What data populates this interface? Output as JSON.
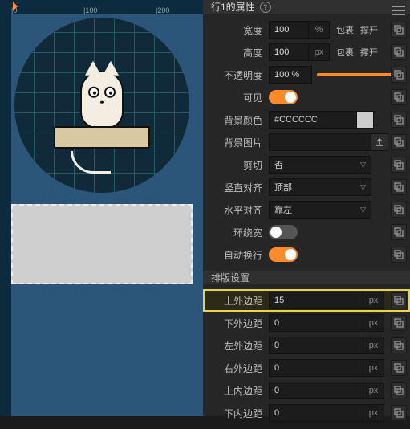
{
  "ruler": {
    "m0": "|0",
    "m100": "|100",
    "m200": "|200"
  },
  "panel": {
    "title": "行1的属性",
    "section_layout": "排版设置"
  },
  "props": {
    "width_label": "宽度",
    "width_value": "100",
    "width_unit": "%",
    "height_label": "高度",
    "height_value": "100",
    "height_unit": "px",
    "opacity_label": "不透明度",
    "opacity_value": "100 %",
    "visible_label": "可见",
    "bgcolor_label": "背景颜色",
    "bgcolor_value": "#CCCCCC",
    "bgimg_label": "背景图片",
    "clip_label": "剪切",
    "clip_value": "否",
    "valign_label": "竖直对齐",
    "valign_value": "顶部",
    "halign_label": "水平对齐",
    "halign_value": "靠左",
    "ring_label": "环绕宽",
    "wrap_label": "自动换行",
    "wrap_chip": "包裹",
    "expand_chip": "撑开"
  },
  "margins": {
    "top_label": "上外边距",
    "top_value": "15",
    "bottom_label": "下外边距",
    "bottom_value": "0",
    "left_label": "左外边距",
    "left_value": "0",
    "right_label": "右外边距",
    "right_value": "0",
    "ptop_label": "上内边距",
    "ptop_value": "0",
    "pbottom_label": "下内边距",
    "pbottom_value": "0",
    "unit": "px"
  }
}
